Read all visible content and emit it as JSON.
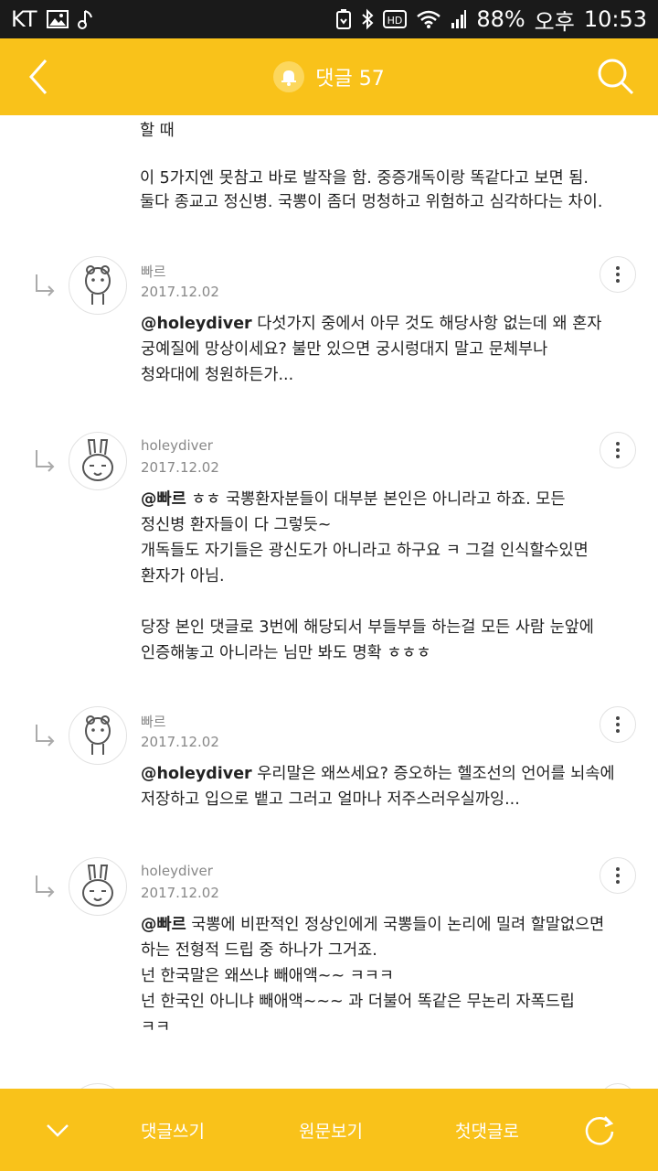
{
  "status": {
    "carrier": "KT",
    "battery": "88%",
    "ampm": "오후",
    "time": "10:53",
    "hd_badge": "HD"
  },
  "header": {
    "title": "댓글 57"
  },
  "top_comment": {
    "partial": "할 때",
    "line1": "이 5가지엔 못참고 바로 발작을 함. 중증개독이랑 똑같다고 보면 됨.",
    "line2": "둘다 종교고 정신병. 국뽕이 좀더 멍청하고 위험하고 심각하다는 차이."
  },
  "comments": [
    {
      "author": "빠르",
      "date": "2017.12.02",
      "mention": "@holeydiver",
      "lines": [
        " 다섯가지 중에서 아무 것도 해당사항 없는데 왜 혼자",
        "궁예질에 망상이세요? 불만 있으면 궁시렁대지 말고 문체부나",
        "청와대에 청원하든가..."
      ]
    },
    {
      "author": "holeydiver",
      "date": "2017.12.02",
      "mention": "@빠르",
      "lines": [
        " ㅎㅎ 국뽕환자분들이 대부분 본인은 아니라고 하죠. 모든",
        "정신병 환자들이 다 그렇듯~",
        "개독들도 자기들은 광신도가 아니라고 하구요 ㅋ 그걸 인식할수있면",
        "환자가 아님.",
        "",
        "당장 본인 댓글로 3번에 해당되서 부들부들 하는걸 모든 사람 눈앞에",
        "인증해놓고 아니라는 님만 봐도 명확 ㅎㅎㅎ"
      ]
    },
    {
      "author": "빠르",
      "date": "2017.12.02",
      "mention": "@holeydiver",
      "lines": [
        " 우리말은 왜쓰세요? 증오하는 헬조선의 언어를 뇌속에",
        "저장하고 입으로 뱉고 그러고 얼마나 저주스러우실까잉..."
      ]
    },
    {
      "author": "holeydiver",
      "date": "2017.12.02",
      "mention": "@빠르",
      "lines": [
        " 국뽕에 비판적인 정상인에게 국뽕들이 논리에 밀려 할말없으면",
        "하는 전형적 드립 중 하나가 그거죠.",
        "넌 한국말은 왜쓰냐 빼애액~~ ㅋㅋㅋ",
        "넌 한국인 아니냐 빼애액~~~ 과 더불어 똑같은 무논리 자폭드립",
        "ㅋㅋ"
      ]
    }
  ],
  "bottom": {
    "write": "댓글쓰기",
    "original": "원문보기",
    "first": "첫댓글로"
  },
  "colors": {
    "accent": "#f9c21a",
    "status_bar": "#1a1a1a",
    "meta_text": "#888888"
  }
}
